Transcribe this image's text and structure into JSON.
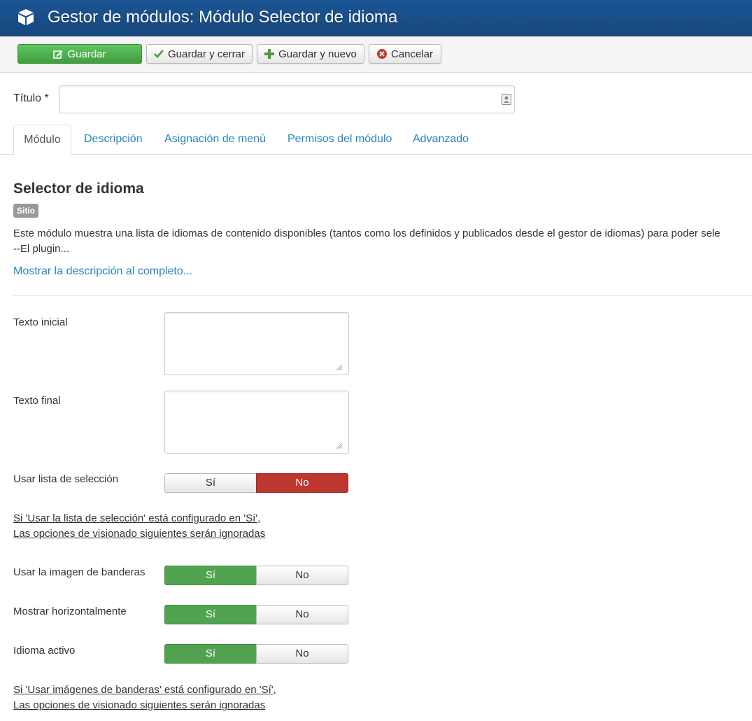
{
  "header": {
    "title": "Gestor de módulos: Módulo Selector de idioma",
    "icon": "cube-icon"
  },
  "toolbar": {
    "save_label": "Guardar",
    "save_close_label": "Guardar y cerrar",
    "save_new_label": "Guardar y nuevo",
    "cancel_label": "Cancelar"
  },
  "title_field": {
    "label": "Título *",
    "value": "",
    "placeholder": ""
  },
  "tabs": [
    {
      "label": "Módulo",
      "active": true
    },
    {
      "label": "Descripción"
    },
    {
      "label": "Asignación de menú"
    },
    {
      "label": "Permisos del módulo"
    },
    {
      "label": "Advanzado"
    }
  ],
  "module": {
    "name": "Selector de idioma",
    "badge": "Sitio",
    "description_line1": "Este módulo muestra una lista de idiomas de contenido disponibles (tantos como los definidos y publicados desde el gestor de idiomas) para poder sele",
    "description_line2": "--El plugin...",
    "show_more": "Mostrar la descripción al completo..."
  },
  "fields": {
    "pretext_label": "Texto inicial",
    "posttext_label": "Texto final",
    "dropdown_label": "Usar lista de selección",
    "note1_line1": "Si 'Usar la lista de selección' está configurado en 'Sí',",
    "note1_line2": "Las opciones de visionado siguientes serán ignoradas",
    "flags_label": "Usar la imagen de banderas",
    "horizontal_label": "Mostrar horizontalmente",
    "active_label": "Idioma activo",
    "note2_line1": "Si 'Usar imágenes de banderas' está configurado en 'Sí',",
    "note2_line2": "Las opciones de visionado siguientes serán ignoradas"
  },
  "toggle": {
    "yes": "Sí",
    "no": "No"
  },
  "colors": {
    "header": "#17477d",
    "save": "#51a351",
    "no_active": "#bd362f",
    "yes_active": "#51a351",
    "link": "#2a85b8"
  }
}
